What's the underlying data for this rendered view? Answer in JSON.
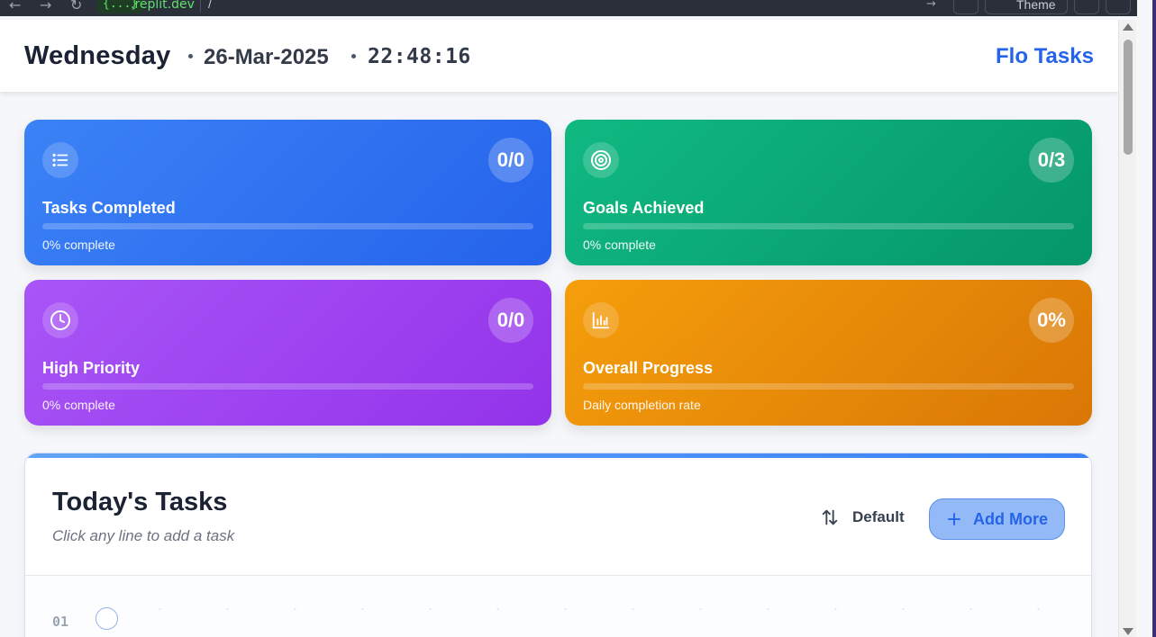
{
  "browser": {
    "url_badge": "{...}",
    "url_host": ".replit.dev",
    "url_path": "/",
    "theme_label": "Theme"
  },
  "header": {
    "day": "Wednesday",
    "date": "26-Mar-2025",
    "time": "22:48:16",
    "brand": "Flo Tasks"
  },
  "stats": [
    {
      "label": "Tasks Completed",
      "count": "0/0",
      "subtitle": "0% complete",
      "icon": "list-icon",
      "color": "#2563eb",
      "progress": 0
    },
    {
      "label": "Goals Achieved",
      "count": "0/3",
      "subtitle": "0% complete",
      "icon": "target-icon",
      "color": "#059669",
      "progress": 0
    },
    {
      "label": "High Priority",
      "count": "0/0",
      "subtitle": "0% complete",
      "icon": "clock-icon",
      "color": "#9333ea",
      "progress": 0
    },
    {
      "label": "Overall Progress",
      "count": "0%",
      "subtitle": "Daily completion rate",
      "icon": "bar-chart-icon",
      "color": "#d97706",
      "progress": 0
    }
  ],
  "tasks": {
    "title": "Today's Tasks",
    "hint": "Click any line to add a task",
    "sort_label": "Default",
    "add_label": "Add More",
    "rows": [
      {
        "number": "01"
      }
    ]
  }
}
